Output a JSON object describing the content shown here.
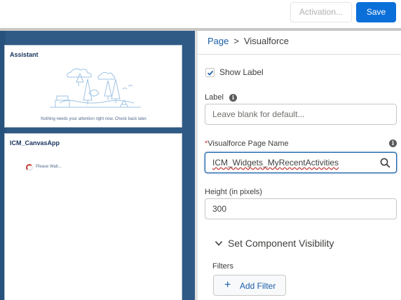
{
  "toolbar": {
    "activation_label": "Activation...",
    "save_label": "Save"
  },
  "canvas": {
    "assistant": {
      "title": "Assistant",
      "message": "Nothing needs your attention right now. Check back later."
    },
    "icm": {
      "title": "ICM_CanvasApp",
      "loading_text": "Please Wait..."
    }
  },
  "panel": {
    "breadcrumb": {
      "parent": "Page",
      "separator": ">",
      "current": "Visualforce"
    },
    "show_label": {
      "label": "Show Label",
      "checked": true
    },
    "label_field": {
      "label": "Label",
      "value": "",
      "placeholder": "Leave blank for default..."
    },
    "vf_page_field": {
      "required_marker": "*",
      "label": "Visualforce Page Name",
      "value": "ICM_Widgets_MyRecentActivities"
    },
    "height_field": {
      "label": "Height (in pixels)",
      "value": "300"
    },
    "visibility_section": {
      "title": "Set Component Visibility",
      "filters_label": "Filters",
      "add_filter_label": "Add Filter"
    }
  },
  "colors": {
    "brand_blue": "#0b6fd9",
    "canvas_blue": "#2f5a86",
    "link_blue": "#1b5fa8",
    "error_red": "#c23934"
  }
}
